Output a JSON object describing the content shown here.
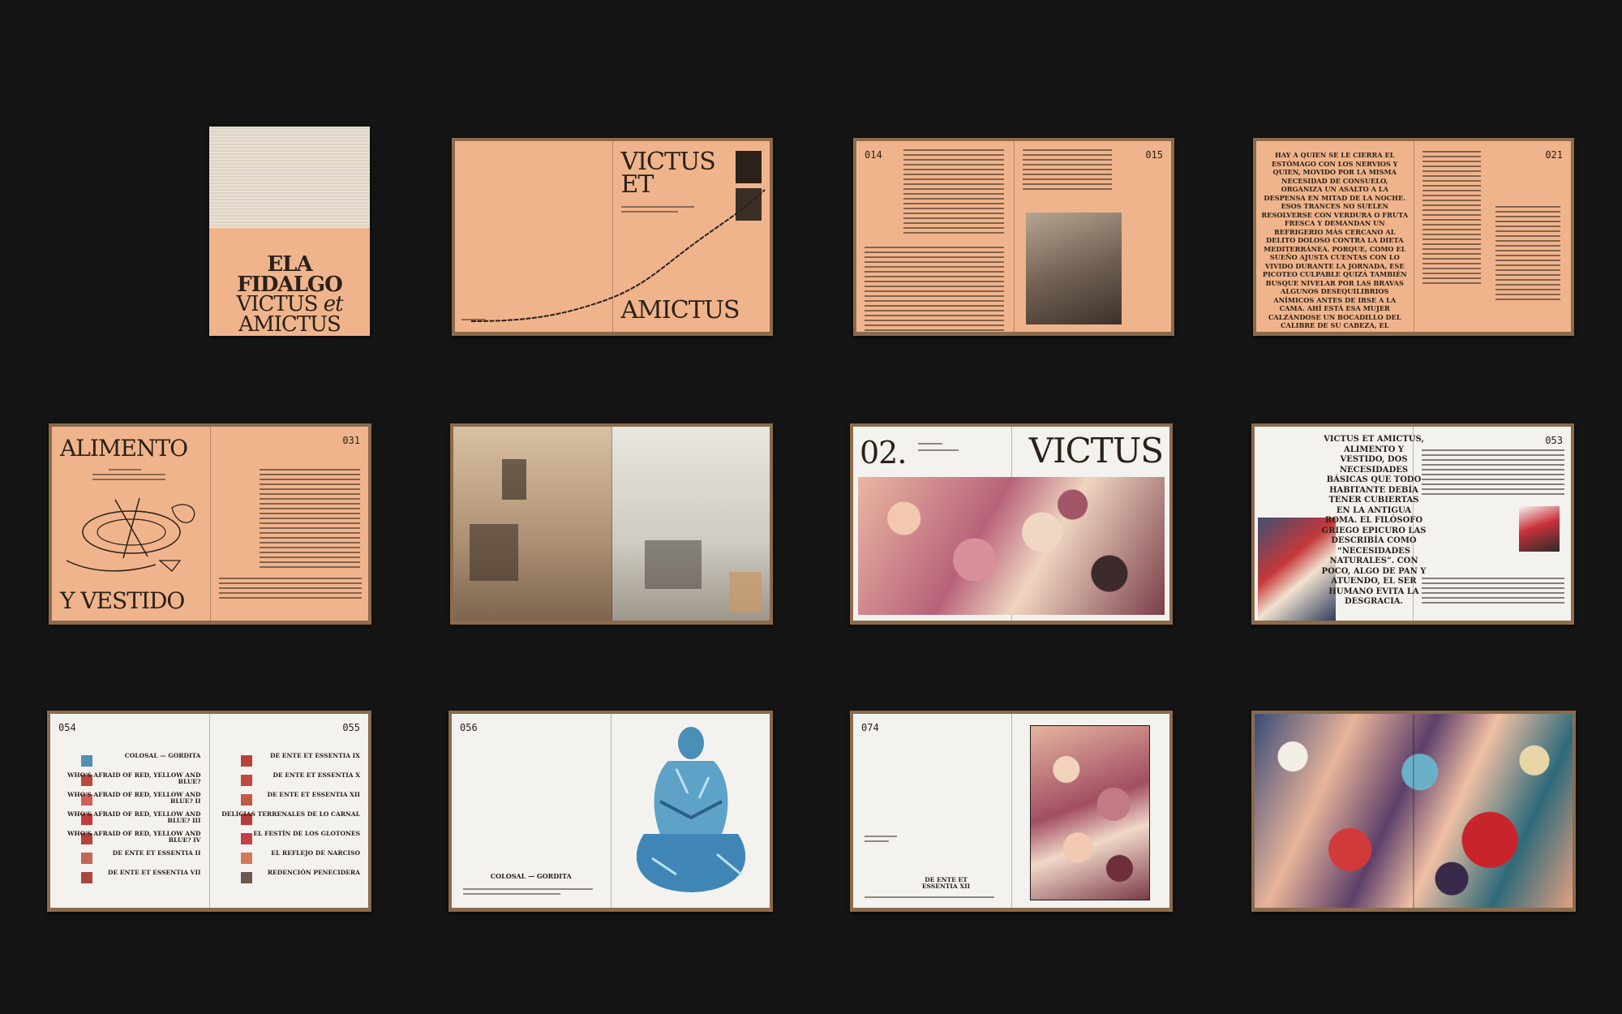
{
  "cover": {
    "line1": "ELA",
    "line2": "FIDALGO",
    "line3a": "VICTUS",
    "line3b": "et",
    "line4": "AMICTUS"
  },
  "spread1": {
    "title1": "VICTUS",
    "title2": "ET",
    "title3": "AMICTUS"
  },
  "spread2": {
    "page_left": "014",
    "page_right": "015"
  },
  "spread3": {
    "page_right": "021",
    "quote": "HAY A QUIEN SE LE CIERRA EL ESTÓMAGO CON LOS NERVIOS Y QUIEN, MOVIDO POR LA MISMA NECESIDAD DE CONSUELO, ORGANIZA UN ASALTO A LA DESPENSA EN MITAD DE LA NOCHE. ESOS TRANCES NO SUELEN RESOLVERSE CON VERDURA O FRUTA FRESCA Y DEMANDAN UN REFRIGERIO MÁS CERCANO AL DELITO DOLOSO CONTRA LA DIETA MEDITERRÁNEA. PORQUE, COMO EL SUEÑO AJUSTA CUENTAS CON LO VIVIDO DURANTE LA JORNADA, ESE PICOTEO CULPABLE QUIZÁ TAMBIÉN BUSQUE NIVELAR POR LAS BRAVAS ALGUNOS DESEQUILIBRIOS ANÍMICOS ANTES DE IRSE A LA CAMA. AHÍ ESTÁ ESA MUJER CALZÁNDOSE UN BOCADILLO DEL CALIBRE DE SU CABEZA, EL MORDISCO FURTIVO AL BORDE SECO DEL TRIÁNGULO DE PIZZA FRÍA, LA MIRADA PERDIDA DE QUIEN SE LLENA LA BOCA PARA VACIARSE LA MENTE POR UN RATO. UN RETABLO DE LA ANSIEDAD VESTIDA DE GULA EN LAS MANOS DE ELA FIDALGO."
  },
  "spread4": {
    "title1": "ALIMENTO",
    "title2": "Y VESTIDO",
    "page_right": "031"
  },
  "spread6": {
    "number": "02.",
    "title": "VICTUS"
  },
  "spread7": {
    "page_right": "053",
    "quote": "VICTUS ET AMICTUS, ALIMENTO Y VESTIDO, DOS NECESIDADES BÁSICAS QUE TODO HABITANTE DEBÍA TENER CUBIERTAS EN LA ANTIGUA ROMA. EL FILÓSOFO GRIEGO EPICURO LAS DESCRIBÍA COMO “NECESIDADES NATURALES”. CON POCO, ALGO DE PAN Y ATUENDO, EL SER HUMANO EVITA LA DESGRACIA."
  },
  "spread8": {
    "page_left": "054",
    "page_right": "055",
    "left_items": [
      "COLOSAL — GORDITA",
      "WHO'S AFRAID OF RED, YELLOW AND BLUE?",
      "WHO'S AFRAID OF RED, YELLOW AND BLUE? II",
      "WHO'S AFRAID OF RED, YELLOW AND BLUE? III",
      "WHO'S AFRAID OF RED, YELLOW AND BLUE? IV",
      "DE ENTE ET ESSENTIA II",
      "DE ENTE ET ESSENTIA VII"
    ],
    "right_items": [
      "DE ENTE ET ESSENTIA IX",
      "DE ENTE ET ESSENTIA X",
      "DE ENTE ET ESSENTIA XII",
      "DELICIAS TERRENALES DE LO CARNAL",
      "EL FESTÍN DE LOS GLOTONES",
      "EL REFLEJO DE NARCISO",
      "REDENCIÓN PENECIDERA"
    ]
  },
  "spread9": {
    "page_left": "056",
    "caption": "COLOSAL — GORDITA"
  },
  "spread10": {
    "page_left": "074",
    "caption": "DE ENTE ET ESSENTIA XII"
  },
  "colors": {
    "background": "#151515",
    "salmon": "#f0b48c",
    "paper": "#f4f2ef",
    "kraft": "#8c6a4c",
    "ink": "#2a2118"
  }
}
